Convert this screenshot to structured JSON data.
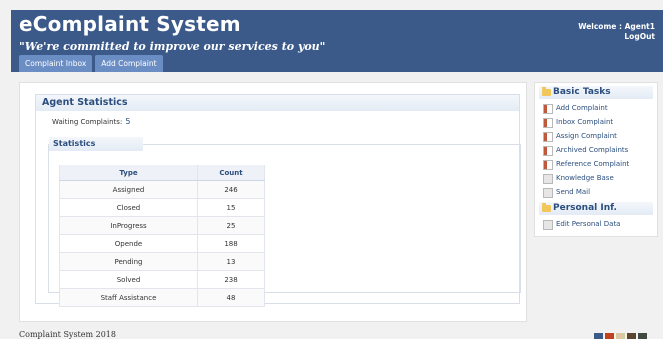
{
  "header": {
    "app_title": "eComplaint System",
    "slogan": "\"We're committed to improve our services to you\"",
    "welcome": "Welcome : Agent1",
    "logout": "LogOut"
  },
  "tabs": [
    {
      "label": "Complaint Inbox"
    },
    {
      "label": "Add Complaint"
    }
  ],
  "agent_stats": {
    "title": "Agent Statistics",
    "waiting_label": "Waiting Complaints:",
    "waiting_value": "5",
    "statistics_title": "Statistics",
    "columns": [
      "Type",
      "Count"
    ],
    "rows": [
      {
        "type": "Assigned",
        "count": "246"
      },
      {
        "type": "Closed",
        "count": "15"
      },
      {
        "type": "InProgress",
        "count": "25"
      },
      {
        "type": "Opende",
        "count": "188"
      },
      {
        "type": "Pending",
        "count": "13"
      },
      {
        "type": "Solved",
        "count": "238"
      },
      {
        "type": "Staff Assistance",
        "count": "48"
      }
    ]
  },
  "sidebar": {
    "basic_title": "Basic Tasks",
    "basic_items": [
      {
        "label": "Add Complaint",
        "icon": "report-icon"
      },
      {
        "label": "Inbox Complaint",
        "icon": "report-icon"
      },
      {
        "label": "Assign Complaint",
        "icon": "report-icon"
      },
      {
        "label": "Archived Complaints",
        "icon": "report-icon"
      },
      {
        "label": "Reference Complaint",
        "icon": "report-icon"
      },
      {
        "label": "Knowledge Base",
        "icon": "page-icon"
      },
      {
        "label": "Send Mail",
        "icon": "page-icon"
      }
    ],
    "personal_title": "Personal Inf.",
    "personal_items": [
      {
        "label": "Edit Personal Data",
        "icon": "page-icon"
      }
    ]
  },
  "footer": {
    "text": "Complaint System 2018"
  },
  "colors": {
    "header_bg": "#3b5a8a",
    "tab_bg": "#6a8ec4",
    "heading": "#2b4e7e",
    "swatches": [
      "#3b5a8a",
      "#c0401f",
      "#d9c8a0",
      "#5a4630",
      "#404a40"
    ]
  }
}
